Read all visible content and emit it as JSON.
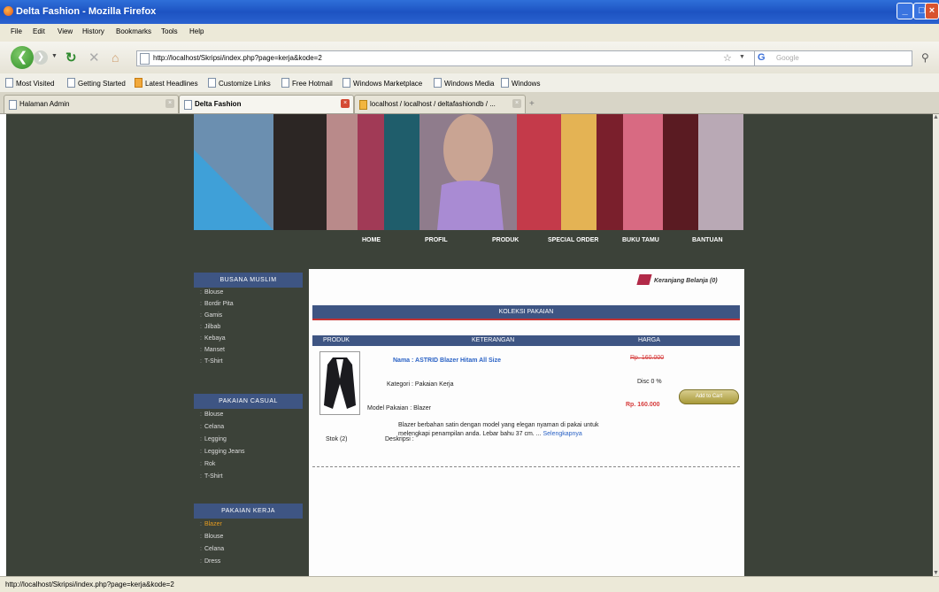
{
  "window": {
    "title": "Delta Fashion - Mozilla Firefox"
  },
  "menu": [
    "File",
    "Edit",
    "View",
    "History",
    "Bookmarks",
    "Tools",
    "Help"
  ],
  "toolbar": {
    "url": "http://localhost/Skripsi/index.php?page=kerja&kode=2",
    "search_placeholder": "Google"
  },
  "bookmarks": [
    "Most Visited",
    "Getting Started",
    "Latest Headlines",
    "Customize Links",
    "Free Hotmail",
    "Windows Marketplace",
    "Windows Media",
    "Windows"
  ],
  "tabs": [
    {
      "label": "Halaman Admin"
    },
    {
      "label": "Delta Fashion"
    },
    {
      "label": "localhost / localhost / deltafashiondb / ..."
    }
  ],
  "site": {
    "nav": [
      "HOME",
      "PROFIL",
      "PRODUK",
      "SPECIAL ORDER",
      "BUKU TAMU",
      "BANTUAN"
    ],
    "sidebar": [
      {
        "title": "BUSANA MUSLIM",
        "items": [
          "Blouse",
          "Bordir Pita",
          "Gamis",
          "Jilbab",
          "Kebaya",
          "Manset",
          "T-Shirt"
        ]
      },
      {
        "title": "PAKAIAN CASUAL",
        "items": [
          "Blouse",
          "Celana",
          "Legging",
          "Legging Jeans",
          "Rok",
          "T-Shirt"
        ]
      },
      {
        "title": "PAKAIAN KERJA",
        "items": [
          "Blazer",
          "Blouse",
          "Celana",
          "Dress"
        ]
      }
    ],
    "cart_label": "Keranjang Belanja (0)",
    "collection_title": "KOLEKSI PAKAIAN",
    "columns": [
      "PRODUK",
      "KETERANGAN",
      "HARGA"
    ],
    "product": {
      "name": "Nama : ASTRID Blazer Hitam All Size",
      "category": "Kategori : Pakaian Kerja",
      "model": "Model Pakaian : Blazer",
      "stock": "Stok (2)",
      "desc_label": "Deskripsi :",
      "description": "Blazer berbahan satin dengan model yang elegan nyaman di pakai untuk melengkapi penampilan anda. Lebar bahu 37 cm. ...",
      "more": "Selengkapnya",
      "price_old": "Rp. 160.000",
      "discount": "Disc 0 %",
      "price_new": "Rp. 160.000",
      "add_to_cart": "Add to Cart"
    }
  },
  "status": "http://localhost/Skripsi/index.php?page=kerja&kode=2"
}
